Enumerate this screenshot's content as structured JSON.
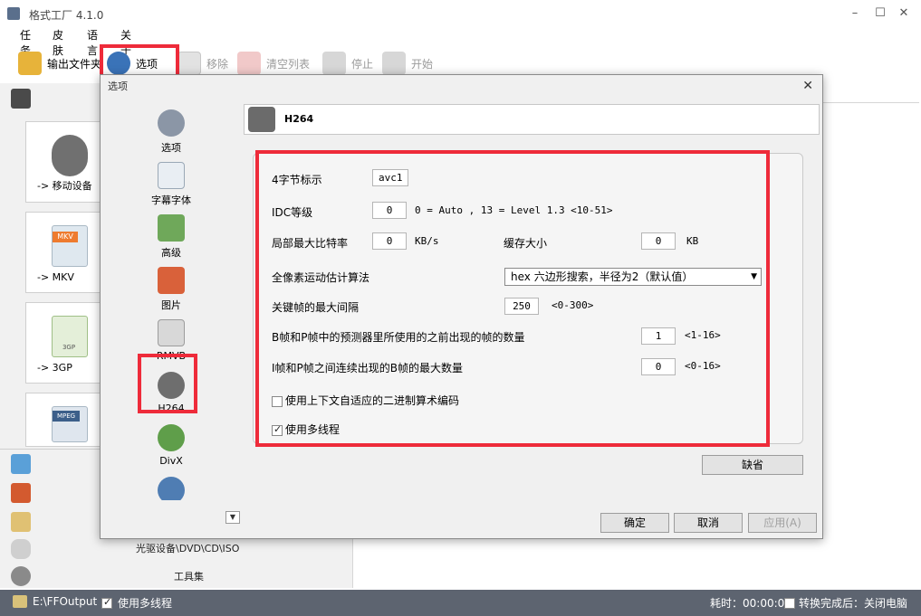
{
  "window": {
    "title": "格式工厂 4.1.0",
    "min": "–",
    "max": "☐",
    "close": "✕"
  },
  "menu": [
    "任务",
    "皮肤",
    "语言",
    "关于"
  ],
  "toolbar": {
    "output_folder": "输出文件夹",
    "options": "选项",
    "remove": "移除",
    "clear_list": "清空列表",
    "stop": "停止",
    "start": "开始"
  },
  "left_panel": {
    "cards": [
      "-> 移动设备",
      "-> MKV",
      "-> 3GP",
      ""
    ],
    "card_badges": [
      "",
      "MKV",
      "3GP",
      "MPEG"
    ],
    "optical": "光驱设备\\DVD\\CD\\ISO",
    "tools": "工具集"
  },
  "statusbar": {
    "output_path": "E:\\FFOutput",
    "multithread": "使用多线程",
    "elapsed": "耗时：00:00:00",
    "after_done": "转换完成后：关闭电脑"
  },
  "dialog": {
    "title": "选项",
    "close": "✕",
    "nav": [
      "选项",
      "字幕字体",
      "高级",
      "图片",
      "RMVB",
      "H264",
      "DivX",
      ""
    ],
    "header": "H264",
    "fields": {
      "fourcc_label": "4字节标示",
      "fourcc_value": "avc1",
      "idc_label": "IDC等级",
      "idc_value": "0",
      "idc_hint": "0 = Auto , 13 = Level 1.3 <10-51>",
      "maxrate_label": "局部最大比特率",
      "maxrate_value": "0",
      "maxrate_unit": "KB/s",
      "buffer_label": "缓存大小",
      "buffer_value": "0",
      "buffer_unit": "KB",
      "me_label": "全像素运动估计算法",
      "me_value": "hex  六边形搜索，半径为2（默认值）",
      "keyint_label": "关键帧的最大间隔",
      "keyint_value": "250",
      "keyint_hint": "<0-300>",
      "ref_label": "B帧和P帧中的预测器里所使用的之前出现的帧的数量",
      "ref_value": "1",
      "ref_hint": "<1-16>",
      "bframes_label": "I帧和P帧之间连续出现的B帧的最大数量",
      "bframes_value": "0",
      "bframes_hint": "<0-16>",
      "cabac_label": "使用上下文自适应的二进制算术编码",
      "threads_label": "使用多线程"
    },
    "default_btn": "缺省",
    "ok": "确定",
    "cancel": "取消",
    "apply": "应用(A)"
  },
  "colors": {
    "highlight": "#ee2b3a",
    "statusbar": "#5d6470"
  }
}
